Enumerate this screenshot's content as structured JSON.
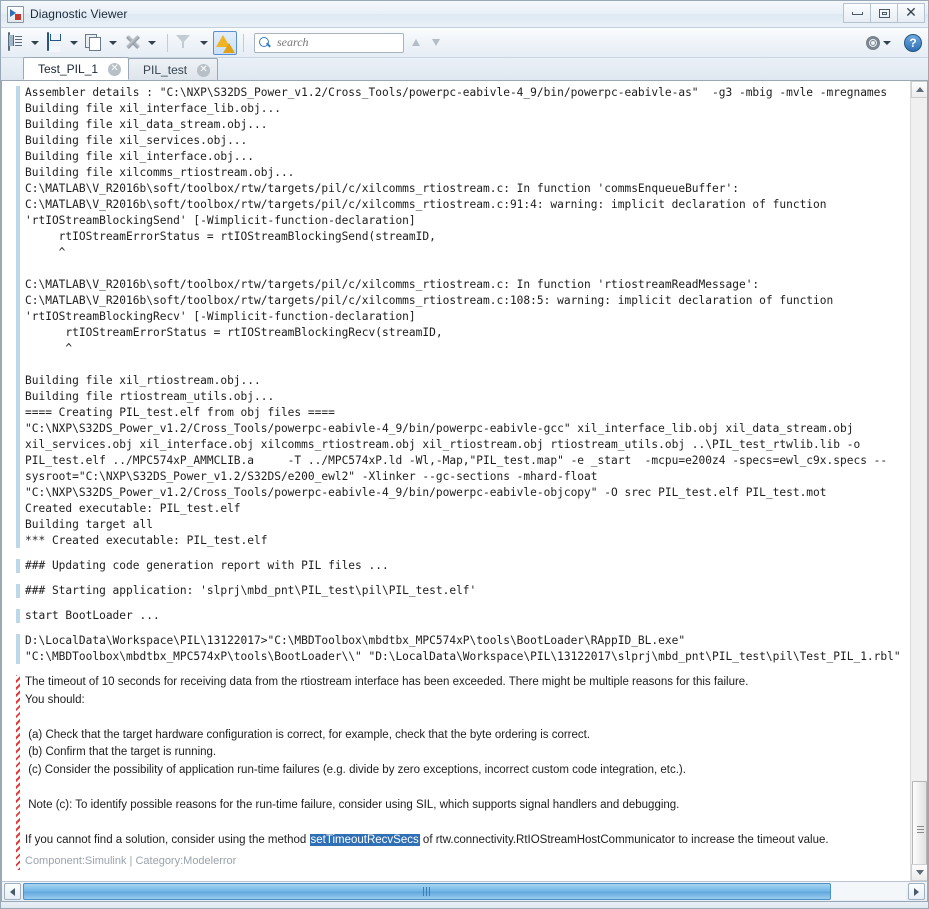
{
  "window": {
    "title": "Diagnostic Viewer",
    "icon": "diagnostic-viewer-icon",
    "minimize_label": "",
    "maximize_label": "",
    "close_label": "✕"
  },
  "toolbar": {
    "items": [
      {
        "name": "view-options",
        "icon": "list-view-icon"
      },
      {
        "name": "save",
        "icon": "save-icon"
      },
      {
        "name": "copy",
        "icon": "copy-icon"
      },
      {
        "name": "clear",
        "icon": "clear-x-icon"
      },
      {
        "name": "filter",
        "icon": "funnel-icon"
      },
      {
        "name": "warnings-errors",
        "icon": "warning-icon"
      }
    ],
    "search": {
      "placeholder": "search",
      "value": ""
    },
    "nav_up": "up-arrow-icon",
    "nav_down": "down-arrow-icon",
    "settings": "gear-icon",
    "help": "?"
  },
  "tabs": [
    {
      "label": "Test_PIL_1",
      "active": true,
      "close": "✕"
    },
    {
      "label": "PIL_test",
      "active": false,
      "close": "✕"
    }
  ],
  "log": {
    "messages": [
      {
        "severity": "info",
        "lines": [
          "Assembler details : \"C:\\NXP\\S32DS_Power_v1.2/Cross_Tools/powerpc-eabivle-4_9/bin/powerpc-eabivle-as\"  -g3 -mbig -mvle -mregnames",
          "Building file xil_interface_lib.obj...",
          "Building file xil_data_stream.obj...",
          "Building file xil_services.obj...",
          "Building file xil_interface.obj...",
          "Building file xilcomms_rtiostream.obj...",
          "C:\\MATLAB\\V_R2016b\\soft/toolbox/rtw/targets/pil/c/xilcomms_rtiostream.c: In function 'commsEnqueueBuffer':",
          "C:\\MATLAB\\V_R2016b\\soft/toolbox/rtw/targets/pil/c/xilcomms_rtiostream.c:91:4: warning: implicit declaration of function",
          "'rtIOStreamBlockingSend' [-Wimplicit-function-declaration]",
          "     rtIOStreamErrorStatus = rtIOStreamBlockingSend(streamID,",
          "     ^",
          "",
          "C:\\MATLAB\\V_R2016b\\soft/toolbox/rtw/targets/pil/c/xilcomms_rtiostream.c: In function 'rtiostreamReadMessage':",
          "C:\\MATLAB\\V_R2016b\\soft/toolbox/rtw/targets/pil/c/xilcomms_rtiostream.c:108:5: warning: implicit declaration of function",
          "'rtIOStreamBlockingRecv' [-Wimplicit-function-declaration]",
          "      rtIOStreamErrorStatus = rtIOStreamBlockingRecv(streamID,",
          "      ^",
          "",
          "Building file xil_rtiostream.obj...",
          "Building file rtiostream_utils.obj...",
          "==== Creating PIL_test.elf from obj files ====",
          "\"C:\\NXP\\S32DS_Power_v1.2/Cross_Tools/powerpc-eabivle-4_9/bin/powerpc-eabivle-gcc\" xil_interface_lib.obj xil_data_stream.obj",
          "xil_services.obj xil_interface.obj xilcomms_rtiostream.obj xil_rtiostream.obj rtiostream_utils.obj ..\\PIL_test_rtwlib.lib -o",
          "PIL_test.elf ../MPC574xP_AMMCLIB.a     -T ../MPC574xP.ld -Wl,-Map,\"PIL_test.map\" -e _start  -mcpu=e200z4 -specs=ewl_c9x.specs --",
          "sysroot=\"C:\\NXP\\S32DS_Power_v1.2/S32DS/e200_ewl2\" -Xlinker --gc-sections -mhard-float",
          "\"C:\\NXP\\S32DS_Power_v1.2/Cross_Tools/powerpc-eabivle-4_9/bin/powerpc-eabivle-objcopy\" -O srec PIL_test.elf PIL_test.mot",
          "Created executable: PIL_test.elf",
          "Building target all",
          "*** Created executable: PIL_test.elf"
        ]
      },
      {
        "severity": "info",
        "lines": [
          "### Updating code generation report with PIL files ..."
        ]
      },
      {
        "severity": "info",
        "lines": [
          "### Starting application: 'slprj\\mbd_pnt\\PIL_test\\pil\\PIL_test.elf'"
        ]
      },
      {
        "severity": "info",
        "lines": [
          "start BootLoader ..."
        ]
      },
      {
        "severity": "info",
        "lines": [
          "D:\\LocalData\\Workspace\\PIL\\13122017>\"C:\\MBDToolbox\\mbdtbx_MPC574xP\\tools\\BootLoader\\RAppID_BL.exe\"",
          "\"C:\\MBDToolbox\\mbdtbx_MPC574xP\\tools\\BootLoader\\\\\" \"D:\\LocalData\\Workspace\\PIL\\13122017\\slprj\\mbd_pnt\\PIL_test\\pil\\Test_PIL_1.rbl\""
        ]
      }
    ],
    "error_message": {
      "severity": "error",
      "para1": "The timeout of 10 seconds for receiving data from the rtiostream interface has been exceeded. There might be multiple reasons for this failure.",
      "para2": "You should:",
      "bullets": [
        " (a) Check that the target hardware configuration is correct, for example, check that the byte ordering is correct.",
        " (b) Confirm that the target is running.",
        " (c) Consider the possibility of application run-time failures (e.g. divide by zero exceptions, incorrect custom code integration, etc.)."
      ],
      "note": " Note (c): To identify possible reasons for the run-time failure, consider using SIL, which supports signal handlers and debugging.",
      "solution_prefix": "If you cannot find a solution, consider using the method ",
      "solution_highlight": "setTimeoutRecvSecs",
      "solution_suffix": " of rtw.connectivity.RtIOStreamHostCommunicator to increase the timeout value.",
      "component_line": "Component:Simulink | Category:Modelerror"
    }
  },
  "scrollbars": {
    "vertical": {
      "up": "scroll-up-icon",
      "down": "scroll-down-icon"
    },
    "horizontal": {
      "left": "scroll-left-icon",
      "right": "scroll-right-icon"
    }
  },
  "colors": {
    "info_bar": "#bcd9ea",
    "error_bar": "#e23b3b",
    "accent": "#2f6fb5",
    "highlight_bg": "#2f6fb5"
  }
}
